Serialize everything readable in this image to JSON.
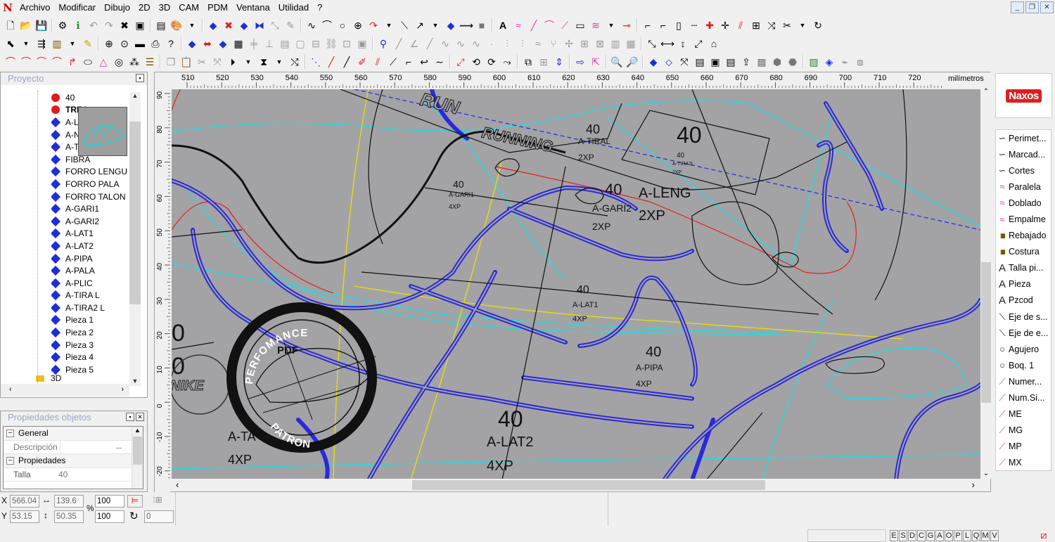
{
  "menu": {
    "items": [
      "Archivo",
      "Modificar",
      "Dibujo",
      "2D",
      "3D",
      "CAM",
      "PDM",
      "Ventana",
      "Utilidad",
      "?"
    ]
  },
  "project": {
    "title": "Proyecto",
    "items": [
      {
        "label": "40",
        "type": "dot"
      },
      {
        "label": "TREA",
        "type": "dot"
      },
      {
        "label": "A-L",
        "type": "diamond"
      },
      {
        "label": "A-N",
        "type": "diamond"
      },
      {
        "label": "A-T",
        "type": "diamond"
      },
      {
        "label": "FIBRA",
        "type": "diamond"
      },
      {
        "label": "FORRO LENGU",
        "type": "diamond"
      },
      {
        "label": "FORRO PALA",
        "type": "diamond"
      },
      {
        "label": "FORRO TALON",
        "type": "diamond"
      },
      {
        "label": "A-GARI1",
        "type": "diamond"
      },
      {
        "label": "A-GARI2",
        "type": "diamond"
      },
      {
        "label": "A-LAT1",
        "type": "diamond"
      },
      {
        "label": "A-LAT2",
        "type": "diamond"
      },
      {
        "label": "A-PIPA",
        "type": "diamond"
      },
      {
        "label": "A-PALA",
        "type": "diamond"
      },
      {
        "label": "A-PLIC",
        "type": "diamond"
      },
      {
        "label": "A-TIRA L",
        "type": "diamond"
      },
      {
        "label": "A-TIRA2 L",
        "type": "diamond"
      },
      {
        "label": "Pieza 1",
        "type": "diamond"
      },
      {
        "label": "Pieza 2",
        "type": "diamond"
      },
      {
        "label": "Pieza 3",
        "type": "diamond"
      },
      {
        "label": "Pieza 4",
        "type": "diamond"
      },
      {
        "label": "Pieza 5",
        "type": "diamond"
      }
    ],
    "partial_item": "3D"
  },
  "properties": {
    "title": "Propiedades objetos",
    "general": "General",
    "descripcion_label": "Descripción",
    "descripcion_value": "",
    "propiedades": "Propiedades",
    "talla_label": "Talla",
    "talla_value": "40"
  },
  "ruler": {
    "unit": "milímetros",
    "top_ticks": [
      "510",
      "520",
      "530",
      "540",
      "550",
      "560",
      "570",
      "580",
      "590",
      "600",
      "610",
      "620",
      "630",
      "640",
      "650",
      "660",
      "670",
      "680",
      "690",
      "700",
      "710",
      "720"
    ],
    "left_ticks": [
      "90",
      "80",
      "70",
      "60",
      "50",
      "40",
      "30",
      "20",
      "10",
      "0",
      "-10",
      "-20"
    ]
  },
  "canvas": {
    "labels": [
      "RUN",
      "RUNNING",
      "40",
      "A-TIRAL",
      "2XP",
      "40",
      "40",
      "A-TIRA2L",
      "2XP",
      "40",
      "A-GARI1",
      "4XP",
      "40",
      "A-LENG",
      "A-GARI2",
      "2XP",
      "2XP",
      "40",
      "A-LAT1",
      "4XP",
      "40",
      "A-PIPA",
      "4XP",
      "40",
      "A-LAT2",
      "4XP",
      "A-TA",
      "4XP",
      "NIKE",
      "0",
      "0"
    ],
    "stamp": {
      "top": "PERFOMANCE",
      "center": "PDF",
      "bottom": "PATRON"
    }
  },
  "brand": {
    "logo": "Naxos"
  },
  "tools": [
    {
      "label": "Perimet...",
      "icon": "curve",
      "color": "#222"
    },
    {
      "label": "Marcad...",
      "icon": "curve",
      "color": "#222"
    },
    {
      "label": "Cortes",
      "icon": "curve",
      "color": "#222"
    },
    {
      "label": "Paralela",
      "icon": "wave",
      "color": "#d63aa0"
    },
    {
      "label": "Doblado",
      "icon": "wave",
      "color": "#d63aa0"
    },
    {
      "label": "Empalme",
      "icon": "wave",
      "color": "#d63aa0"
    },
    {
      "label": "Rebajado",
      "icon": "bars",
      "color": "#7a5a00"
    },
    {
      "label": "Costura",
      "icon": "bars",
      "color": "#7a5a00"
    },
    {
      "label": "Talla pi...",
      "icon": "A",
      "color": "#222"
    },
    {
      "label": "Pieza",
      "icon": "A",
      "color": "#222"
    },
    {
      "label": "Pzcod",
      "icon": "A",
      "color": "#222"
    },
    {
      "label": "Eje de s...",
      "icon": "axis",
      "color": "#222"
    },
    {
      "label": "Eje de e...",
      "icon": "axis",
      "color": "#222"
    },
    {
      "label": "Agujero",
      "icon": "circle",
      "color": "#222"
    },
    {
      "label": "Boq. 1",
      "icon": "circle",
      "color": "#222"
    },
    {
      "label": "Numer...",
      "icon": "slash",
      "color": "#d63aa0"
    },
    {
      "label": "Num.Si...",
      "icon": "slash",
      "color": "#d63aa0"
    },
    {
      "label": "ME",
      "icon": "slash",
      "color": "#d63aa0"
    },
    {
      "label": "MG",
      "icon": "slash",
      "color": "#d63aa0"
    },
    {
      "label": "MP",
      "icon": "slash",
      "color": "#d63aa0"
    },
    {
      "label": "MX",
      "icon": "slash",
      "color": "#d63aa0"
    }
  ],
  "status": {
    "x_label": "X",
    "x_value": "566.04",
    "y_label": "Y",
    "y_value": "53.15",
    "w_value": "139.6",
    "h_value": "50.35",
    "zoom1": "100",
    "zoom2": "100",
    "pct": "%",
    "angle": "0",
    "modes": [
      "E",
      "S",
      "D",
      "C",
      "G",
      "A",
      "O",
      "P",
      "L",
      "Q",
      "M",
      "V"
    ]
  }
}
